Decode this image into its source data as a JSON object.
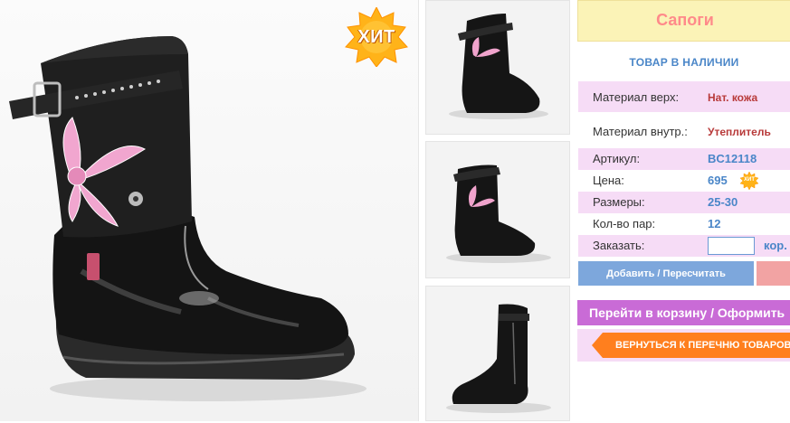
{
  "badge": {
    "main_label": "ХИТ",
    "mini_label": "ХИТ"
  },
  "product": {
    "title": "Сапоги",
    "stock_status": "ТОВАР В НАЛИЧИИ",
    "specs": {
      "material_top_label": "Материал верх:",
      "material_top_value": "Нат. кожа",
      "material_inner_label": "Материал внутр.:",
      "material_inner_value": "Утеплитель",
      "article_label": "Артикул:",
      "article_value": "BC12118",
      "price_label": "Цена:",
      "price_value": "695",
      "sizes_label": "Размеры:",
      "sizes_value": "25-30",
      "pairs_label": "Кол-во пар:",
      "pairs_value": "12",
      "order_label": "Заказать:",
      "order_unit": "кор.",
      "order_qty_value": ""
    }
  },
  "actions": {
    "add_label": "Добавить / Пересчитать",
    "cart_label": "Перейти в корзину / Оформить",
    "back_label": "ВЕРНУТЬСЯ К ПЕРЕЧНЮ ТОВАРОВ"
  },
  "colors": {
    "title_bg": "#fbf3b7",
    "title_text": "#ff8a8a",
    "accent_blue": "#4a86c8",
    "row_pink": "#f6dcf6",
    "cart_purple": "#c96bd6",
    "back_orange": "#ff7f1e"
  },
  "icons": {
    "hit_badge": "starburst-hit-icon",
    "back_arrow": "arrow-left-icon"
  }
}
